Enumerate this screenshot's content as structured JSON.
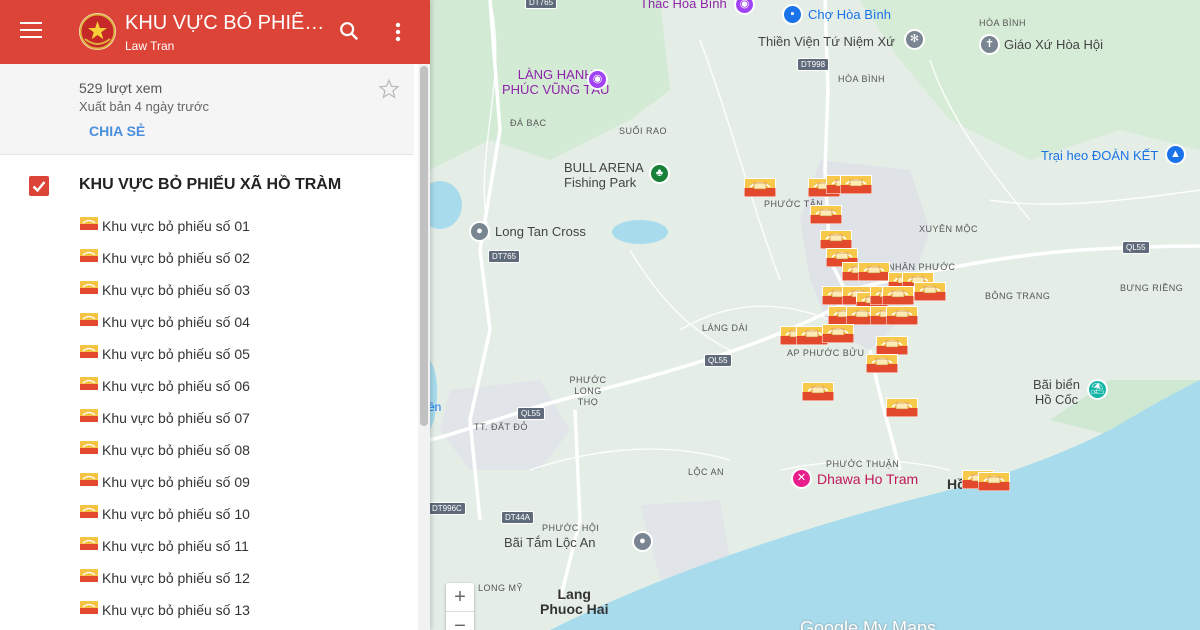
{
  "header": {
    "title": "KHU VỰC BỎ PHIẾU XÃ HỒ TRÀM",
    "author": "Law Tran",
    "brand_color": "#db4437"
  },
  "info": {
    "views": "529 lượt xem",
    "published": "Xuất bản 4 ngày trước",
    "share_label": "CHIA SẺ"
  },
  "layer": {
    "title": "KHU VỰC BỎ PHIẾU XÃ HỒ TRÀM",
    "checked": true,
    "items": [
      "Khu vực bỏ phiếu số 01",
      "Khu vực bỏ phiếu số 02",
      "Khu vực bỏ phiếu số 03",
      "Khu vực bỏ phiếu số 04",
      "Khu vực bỏ phiếu số 05",
      "Khu vực bỏ phiếu số 06",
      "Khu vực bỏ phiếu số 07",
      "Khu vực bỏ phiếu số 08",
      "Khu vực bỏ phiếu số 09",
      "Khu vực bỏ phiếu số 10",
      "Khu vực bỏ phiếu số 11",
      "Khu vực bỏ phiếu số 12",
      "Khu vực bỏ phiếu số 13"
    ]
  },
  "map": {
    "places": {
      "hoa_binh": "HÒA BÌNH",
      "hoa_hoi": "HÒA HỘI",
      "da_bac": "ĐÁ BẠC",
      "suoi_rao": "SUỐI RAO",
      "phuoc_tan": "PHƯỚC TÂN",
      "xuyen_moc": "XUYÊN MỘC",
      "nhan_phuoc": "NHÂN PHƯỚC",
      "bong_trang": "BÔNG TRANG",
      "bung_rieng": "BƯNG RIỀNG",
      "lang_dai": "LÁNG DÀI",
      "ap_phuoc_buu": "AP PHƯỚC BỬU",
      "phuoc_long_tho": "PHƯỚC LONG THỌ",
      "tt_dat_do": "TT. ĐẤT ĐỎ",
      "loc_an": "LỘC AN",
      "phuoc_thuan": "PHƯỚC THUẬN",
      "phuoc_hoi": "PHƯỚC HỘI",
      "long_my": "LONG MỸ"
    },
    "pois": {
      "thac_hoa_binh": "Thác Hòa Bình",
      "cho_hoa_binh": "Chợ Hòa Bình",
      "thien_vien": "Thiền Viện Tứ Niệm Xứ",
      "giao_xu": "Giáo Xứ Hòa Hội",
      "lang_hanh_1": "LÀNG HẠNH",
      "lang_hanh_2": "PHÚC VŨNG TÀU",
      "bull_arena_1": "BULL ARENA",
      "bull_arena_2": "Fishing Park",
      "long_tan_cross": "Long Tan Cross",
      "trai_heo": "Trại heo ĐOÀN KẾT",
      "bai_bien_1": "Bãi biển",
      "bai_bien_2": "Hồ Cốc",
      "dhawa": "Dhawa Ho Tram",
      "bai_tam": "Bãi Tắm Lộc An",
      "lang_phuoc_hai_1": "Lang",
      "lang_phuoc_hai_2": "Phuoc Hai",
      "ho_tram": "Hồ Tràm",
      "left_edge": "ền"
    },
    "roads": {
      "dt765_top": "DT765",
      "dt998": "DT998",
      "dt765": "DT765",
      "ql55_right": "QL55",
      "ql55_mid": "QL55",
      "ql55_left": "QL55",
      "dt996c": "DT996C",
      "dt44a": "DT44A"
    },
    "zoom_in": "+",
    "zoom_out": "−",
    "watermark": "Google My Maps",
    "colors": {
      "sea": "#a8dcec",
      "land": "#e4eee6",
      "park": "#c8e6c9",
      "urban": "#dfe3e8",
      "road_major": "#ffffff"
    }
  }
}
